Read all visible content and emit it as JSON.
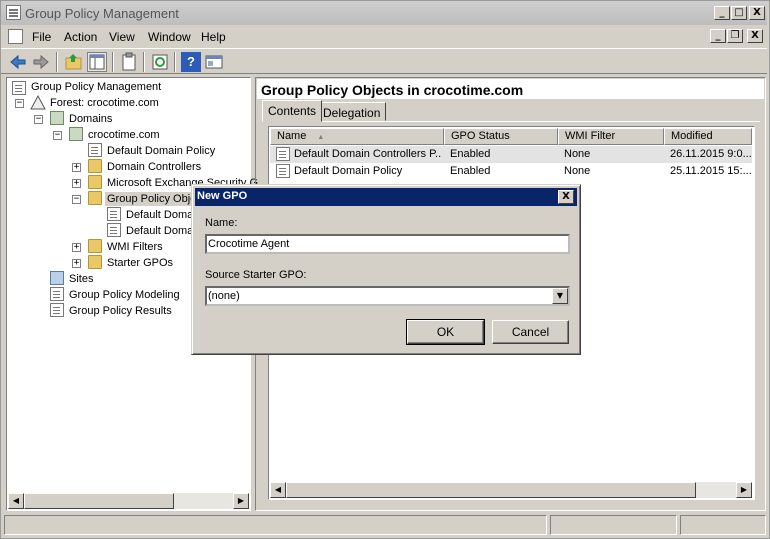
{
  "window": {
    "title": "Group Policy Management"
  },
  "caption_buttons": {
    "minimize": "_",
    "maximize": "□",
    "close": "X"
  },
  "inner_caption_buttons": {
    "minimize": "_",
    "restore": "❐",
    "close": "X"
  },
  "menu": [
    "File",
    "Action",
    "View",
    "Window",
    "Help"
  ],
  "toolbar": {
    "icons": [
      "back-arrow-icon",
      "forward-arrow-icon",
      "up-folder-icon",
      "show-hide-tree-icon",
      "clipboard-icon",
      "refresh-icon",
      "help-icon",
      "properties-icon"
    ],
    "help_glyph": "?"
  },
  "tree": {
    "root": "Group Policy Management",
    "forest": "Forest: crocotime.com",
    "domains": "Domains",
    "domain": "crocotime.com",
    "items": [
      "Default Domain Policy",
      "Domain Controllers",
      "Microsoft Exchange Security G",
      "Group Policy Obje",
      "Default Domai",
      "Default Domai",
      "WMI Filters",
      "Starter GPOs"
    ],
    "sites": "Sites",
    "modeling": "Group Policy Modeling",
    "results": "Group Policy Results",
    "expander_plus": "+",
    "expander_minus": "−"
  },
  "right_pane": {
    "heading": "Group Policy Objects in crocotime.com",
    "tabs": [
      "Contents",
      "Delegation"
    ],
    "columns": [
      "Name",
      "GPO Status",
      "WMI Filter",
      "Modified"
    ],
    "sort_glyph": "▲",
    "rows": [
      {
        "name": "Default Domain Controllers P...",
        "status": "Enabled",
        "wmi": "None",
        "modified": "26.11.2015 9:0..."
      },
      {
        "name": "Default Domain Policy",
        "status": "Enabled",
        "wmi": "None",
        "modified": "25.11.2015 15:..."
      }
    ]
  },
  "scroll_glyphs": {
    "left": "◀",
    "right": "▶"
  },
  "dialog": {
    "title": "New GPO",
    "close_glyph": "X",
    "name_label": "Name:",
    "name_value": "Crocotime Agent",
    "starter_label": "Source Starter GPO:",
    "starter_value": "(none)",
    "dropdown_glyph": "▼",
    "ok": "OK",
    "cancel": "Cancel"
  },
  "colors": {
    "dialog_title_bg": "#0a246a",
    "window_bg": "#d4d0c8",
    "folder": "#e9c866"
  }
}
